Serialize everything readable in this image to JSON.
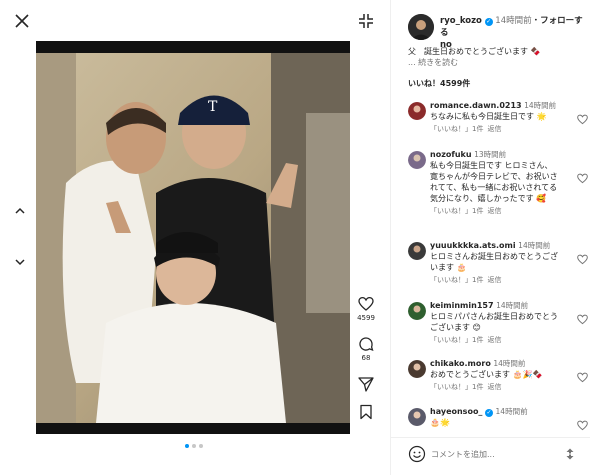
{
  "post": {
    "username": "ryo_kozo",
    "username_rest": "no",
    "time_ago": "14時間前",
    "separator": "・",
    "follow_label": "フォローする",
    "caption": "父　誕生日おめでとうございます",
    "read_more": "... 続きを読む",
    "likes_text": "いいね！4599件",
    "like_count": "4599",
    "comment_count": "68"
  },
  "comments": [
    {
      "user": "romance.dawn.0213",
      "time": "14時間前",
      "text": "ちなみに私も今日誕生日です",
      "reply_likes": "「いいね！」1件",
      "reply": "返信",
      "avatar_color": "#8b2b2b"
    },
    {
      "user": "nozofuku",
      "time": "13時間前",
      "text": "私も今日誕生日です ヒロミさん、寛ちゃんが今日テレビで、お祝いされてて、私も一緒にお祝いされてる気分になり、嬉しかったです",
      "reply_likes": "「いいね！」1件",
      "reply": "返信",
      "avatar_color": "#7a6a8a"
    },
    {
      "user": "yuuukkkka.ats.omi",
      "time": "14時間前",
      "text": "ヒロミさんお誕生日おめでとうございます",
      "reply_likes": "「いいね！」1件",
      "reply": "返信",
      "avatar_color": "#3a3a3a"
    },
    {
      "user": "keiminmin157",
      "time": "14時間前",
      "text": "ヒロミパパさんお誕生日おめでとうございます",
      "reply_likes": "「いいね！」1件",
      "reply": "返信",
      "avatar_color": "#2f5f2f"
    },
    {
      "user": "chikako.moro",
      "time": "14時間前",
      "text": "おめでとうございます",
      "reply_likes": "「いいね！」1件",
      "reply": "返信",
      "avatar_color": "#4a3a30"
    },
    {
      "user": "hayeonsoo_",
      "time": "14時間前",
      "text": "",
      "reply_likes": "",
      "reply": "",
      "avatar_color": "#5a5a6a"
    }
  ],
  "composer": {
    "placeholder": "コメントを追加..."
  },
  "colors": {
    "accent": "#0095f6",
    "muted": "#737373",
    "border": "#efefef"
  },
  "icons": [
    "close-icon",
    "collapse-icon",
    "chevron-up-icon",
    "chevron-down-icon",
    "chevron-right-icon",
    "heart-icon",
    "comment-icon",
    "send-icon",
    "bookmark-icon",
    "emoji-icon",
    "post-icon",
    "verified-icon"
  ]
}
